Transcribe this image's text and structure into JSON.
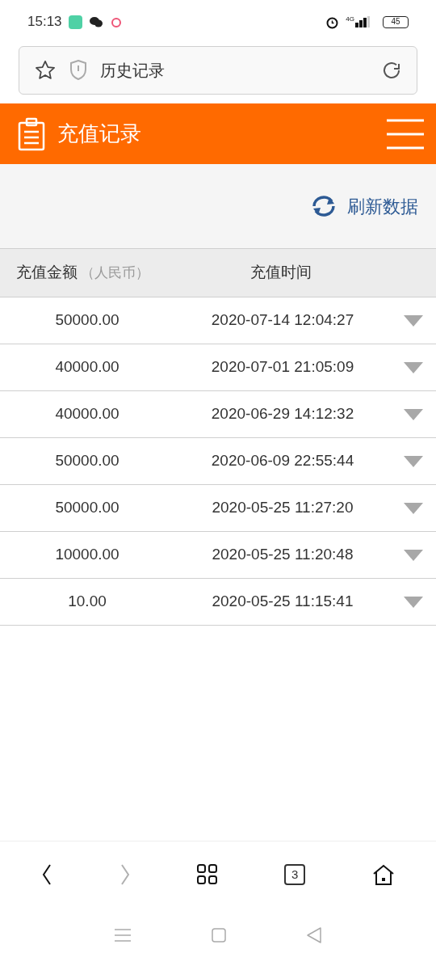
{
  "status_bar": {
    "time": "15:13",
    "network": "4G",
    "battery": "45"
  },
  "address_bar": {
    "title": "历史记录"
  },
  "header": {
    "title": "充值记录"
  },
  "refresh_button": {
    "label": "刷新数据"
  },
  "table": {
    "columns": [
      {
        "label": "充值金额",
        "note": "（人民币）"
      },
      {
        "label": "充值时间"
      }
    ],
    "rows": [
      {
        "amount": "50000.00",
        "time": "2020-07-14 12:04:27"
      },
      {
        "amount": "40000.00",
        "time": "2020-07-01 21:05:09"
      },
      {
        "amount": "40000.00",
        "time": "2020-06-29 14:12:32"
      },
      {
        "amount": "50000.00",
        "time": "2020-06-09 22:55:44"
      },
      {
        "amount": "50000.00",
        "time": "2020-05-25 11:27:20"
      },
      {
        "amount": "10000.00",
        "time": "2020-05-25 11:20:48"
      },
      {
        "amount": "10.00",
        "time": "2020-05-25 11:15:41"
      }
    ]
  },
  "browser_nav": {
    "back_disabled": false,
    "forward_disabled": true,
    "tab_count": "3"
  }
}
